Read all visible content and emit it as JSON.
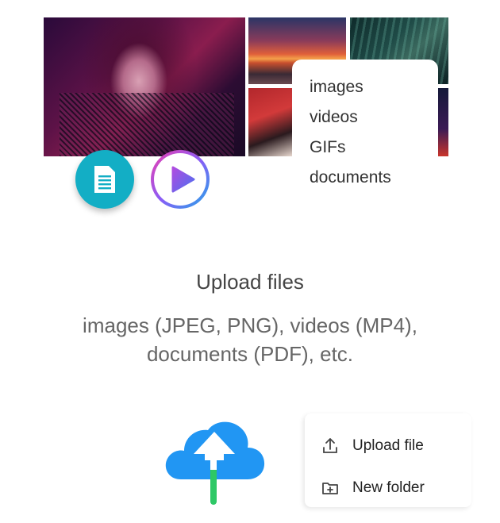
{
  "file_types": [
    "images",
    "videos",
    "GIFs",
    "documents"
  ],
  "upload": {
    "title": "Upload files",
    "subtitle_line1": "images (JPEG, PNG), videos (MP4),",
    "subtitle_line2": "documents (PDF), etc."
  },
  "menu": {
    "upload_file": "Upload file",
    "new_folder": "New folder"
  },
  "icons": {
    "document": "document-icon",
    "play": "play-icon",
    "cloud_upload": "cloud-upload-icon",
    "upload": "upload-file-icon",
    "folder": "new-folder-icon"
  },
  "colors": {
    "doc_button": "#13aec5",
    "cloud": "#2196f3",
    "arrow_stem": "#2ec866"
  }
}
